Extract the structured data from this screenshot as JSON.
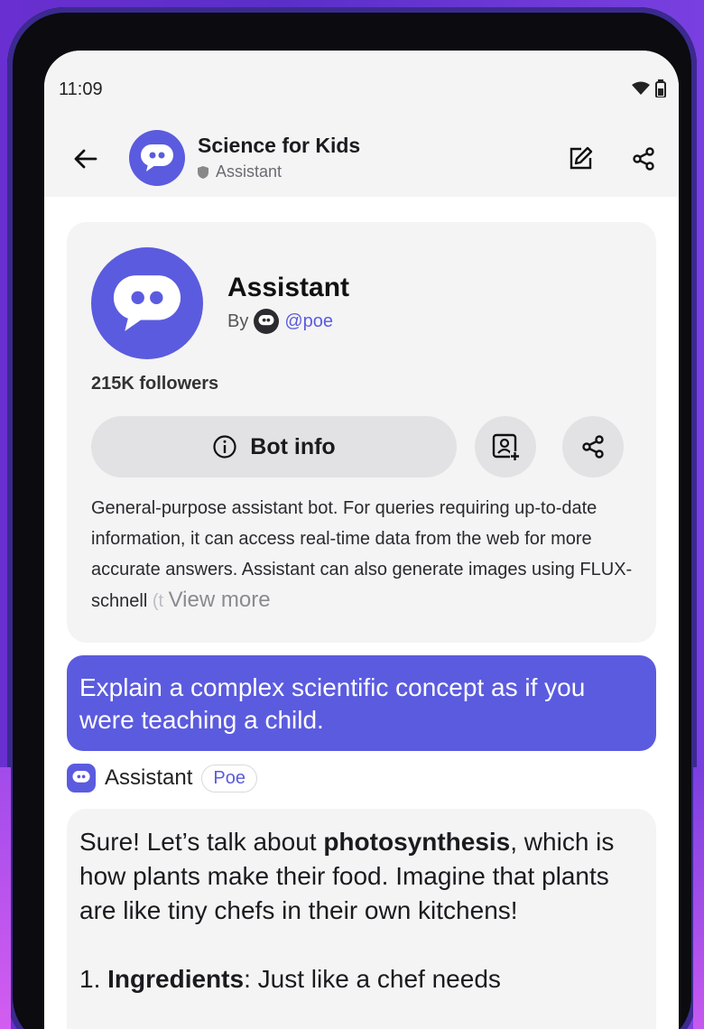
{
  "status": {
    "time": "11:09"
  },
  "header": {
    "title": "Science for Kids",
    "subtitle": "Assistant"
  },
  "bot": {
    "name": "Assistant",
    "by_label": "By",
    "handle": "@poe",
    "followers": "215K followers",
    "info_button": "Bot info",
    "description_main": "General-purpose assistant bot. For queries requiring up-to-date information, it can access real-time data from the web for more accurate answers. Assistant can also generate images using FLUX-schnell",
    "description_fade": " (t",
    "view_more": "View more"
  },
  "user_message": "Explain a complex scientific concept as if you were teaching a child.",
  "reply": {
    "sender": "Assistant",
    "badge": "Poe",
    "para1_a": "Sure! Let’s talk about ",
    "para1_bold": "photosynthesis",
    "para1_b": ", which is how plants make their food. Imagine that plants are like tiny chefs in their own kitchens!",
    "item1_num": "1. ",
    "item1_bold": "Ingredients",
    "item1_text": ": Just like a chef needs"
  },
  "colors": {
    "accent": "#5b5bdf",
    "card": "#f4f4f5",
    "header": "#f4f4f5"
  }
}
